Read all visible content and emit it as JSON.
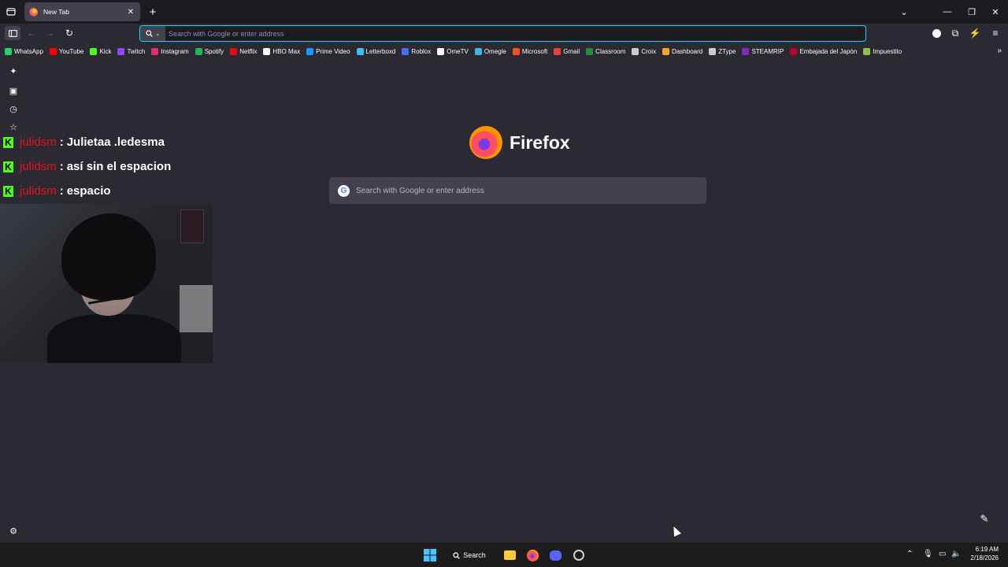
{
  "browser": {
    "tab": {
      "title": "New Tab"
    },
    "urlbar": {
      "placeholder": "Search with Google or enter address"
    },
    "bookmarks": [
      {
        "label": "WhatsApp",
        "icon": "whatsapp-icon",
        "color": "#25d366"
      },
      {
        "label": "YouTube",
        "icon": "youtube-icon",
        "color": "#ff0000"
      },
      {
        "label": "Kick",
        "icon": "kick-icon",
        "color": "#53fc18"
      },
      {
        "label": "Twitch",
        "icon": "twitch-icon",
        "color": "#9146ff"
      },
      {
        "label": "Instagram",
        "icon": "instagram-icon",
        "color": "#e1306c"
      },
      {
        "label": "Spotify",
        "icon": "spotify-icon",
        "color": "#1db954"
      },
      {
        "label": "Netflix",
        "icon": "netflix-icon",
        "color": "#e50914"
      },
      {
        "label": "HBO Max",
        "icon": "hbo-icon",
        "color": "#ffffff"
      },
      {
        "label": "Prime Video",
        "icon": "prime-video-icon",
        "color": "#1a98ff"
      },
      {
        "label": "Letterboxd",
        "icon": "letterboxd-icon",
        "color": "#40bcf4"
      },
      {
        "label": "Roblox",
        "icon": "roblox-icon",
        "color": "#4a6cf7"
      },
      {
        "label": "OmeTV",
        "icon": "ometv-icon",
        "color": "#ffffff"
      },
      {
        "label": "Omegle",
        "icon": "omegle-icon",
        "color": "#43b3e0"
      },
      {
        "label": "Microsoft",
        "icon": "microsoft-icon",
        "color": "#f25022"
      },
      {
        "label": "Gmail",
        "icon": "gmail-icon",
        "color": "#ea4335"
      },
      {
        "label": "Classroom",
        "icon": "classroom-icon",
        "color": "#1e8e3e"
      },
      {
        "label": "Croix",
        "icon": "croix-icon",
        "color": "#cccccc"
      },
      {
        "label": "Dashboard",
        "icon": "dashboard-icon",
        "color": "#f5a623"
      },
      {
        "label": "ZType",
        "icon": "ztype-icon",
        "color": "#cccccc"
      },
      {
        "label": "STEAMRIP",
        "icon": "steamrip-icon",
        "color": "#7b2cbf"
      },
      {
        "label": "Embajada del Japón",
        "icon": "japan-flag-icon",
        "color": "#bc002d"
      },
      {
        "label": "Impuestito",
        "icon": "impuestito-icon",
        "color": "#8bc34a"
      }
    ]
  },
  "newtab": {
    "brand": "Firefox",
    "search_placeholder": "Search with Google or enter address"
  },
  "chat": [
    {
      "user": "julidsm",
      "sep": ":",
      "message": "Julietaa .ledesma"
    },
    {
      "user": "julidsm",
      "sep": ":",
      "message": "así sin el espacion"
    },
    {
      "user": "julidsm",
      "sep": ":",
      "message": "espacio"
    }
  ],
  "taskbar": {
    "search_label": "Search",
    "time": "6:19 AM",
    "date": "2/18/2026"
  },
  "colors": {
    "accent": "#00ddff",
    "kick_green": "#53fc18",
    "chat_user": "#e0151b"
  }
}
